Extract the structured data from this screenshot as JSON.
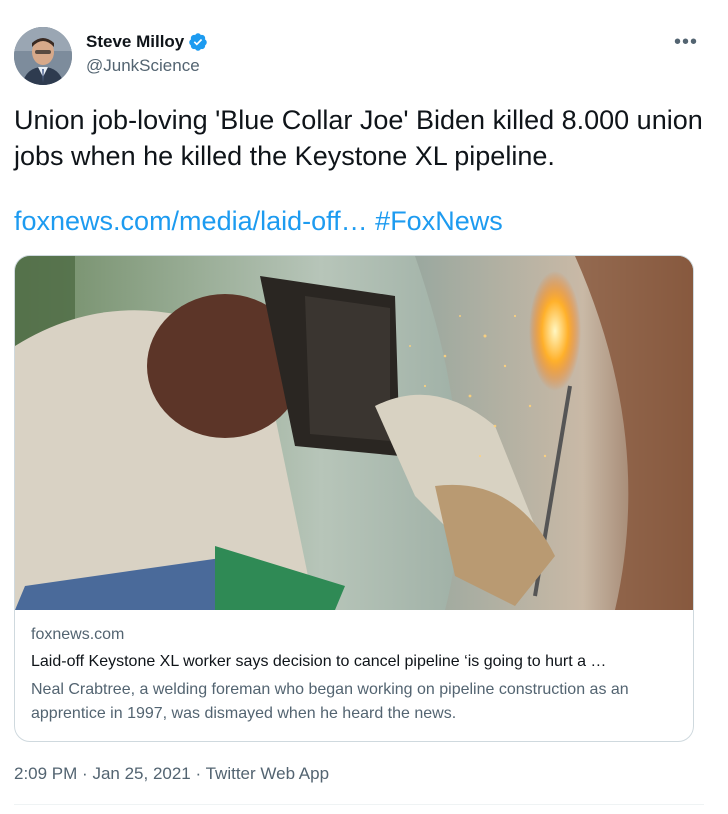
{
  "author": {
    "display_name": "Steve Milloy",
    "handle": "@JunkScience",
    "verified": true,
    "accent_color": "#1d9bf0"
  },
  "more_icon": "•••",
  "tweet": {
    "text": "Union job-loving 'Blue Collar Joe' Biden killed 8.000 union jobs when he killed the Keystone XL pipeline.",
    "link_text": "foxnews.com/media/laid-off…",
    "hashtag": "#FoxNews"
  },
  "card": {
    "domain": "foxnews.com",
    "title": "Laid-off Keystone XL worker says decision to cancel pipeline ‘is going to hurt a …",
    "description": "Neal Crabtree, a welding foreman who began working on pipeline construction as an apprentice in 1997, was dismayed when he heard the news."
  },
  "meta": {
    "time": "2:09 PM",
    "date": "Jan 25, 2021",
    "source": "Twitter Web App",
    "separator": "·"
  }
}
